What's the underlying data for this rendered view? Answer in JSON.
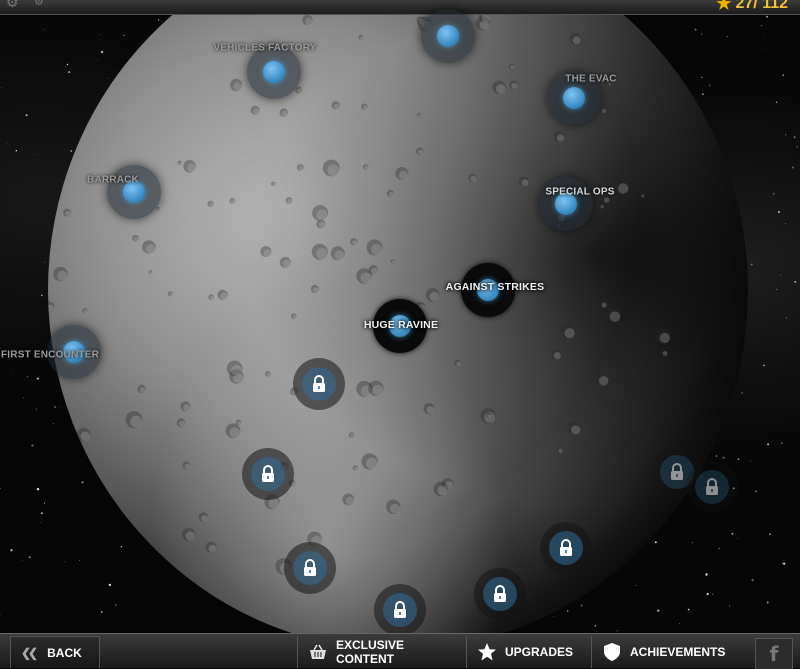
{
  "top_bar": {
    "stars_count": "27/ 112",
    "star_icon": "star-icon",
    "settings_icon": "gear-icon"
  },
  "missions": [
    {
      "id": "vehicles-factory",
      "label": "VEHICLES FACTORY",
      "state": "open"
    },
    {
      "id": "the-evac",
      "label": "THE EVAC",
      "state": "open"
    },
    {
      "id": "barrack",
      "label": "BARRACK",
      "state": "open"
    },
    {
      "id": "special-ops",
      "label": "SPECIAL OPS",
      "state": "open"
    },
    {
      "id": "against-strikes",
      "label": "AGAINST STRIKES",
      "state": "current"
    },
    {
      "id": "huge-ravine",
      "label": "HUGE RAVINE",
      "state": "current"
    },
    {
      "id": "first-encounter",
      "label": "FIRST ENCOUNTER",
      "state": "open"
    },
    {
      "id": "top-node",
      "label": "",
      "state": "open"
    }
  ],
  "locked_count": 9,
  "bottom_bar": {
    "back_label": "BACK",
    "exclusive_label": "EXCLUSIVE CONTENT",
    "upgrades_label": "UPGRADES",
    "achievements_label": "ACHIEVEMENTS",
    "facebook_label": "f"
  },
  "colors": {
    "node_blue": "#3d8fc7",
    "star_gold": "#f2b000",
    "bar_dark": "#1a1a1a"
  }
}
